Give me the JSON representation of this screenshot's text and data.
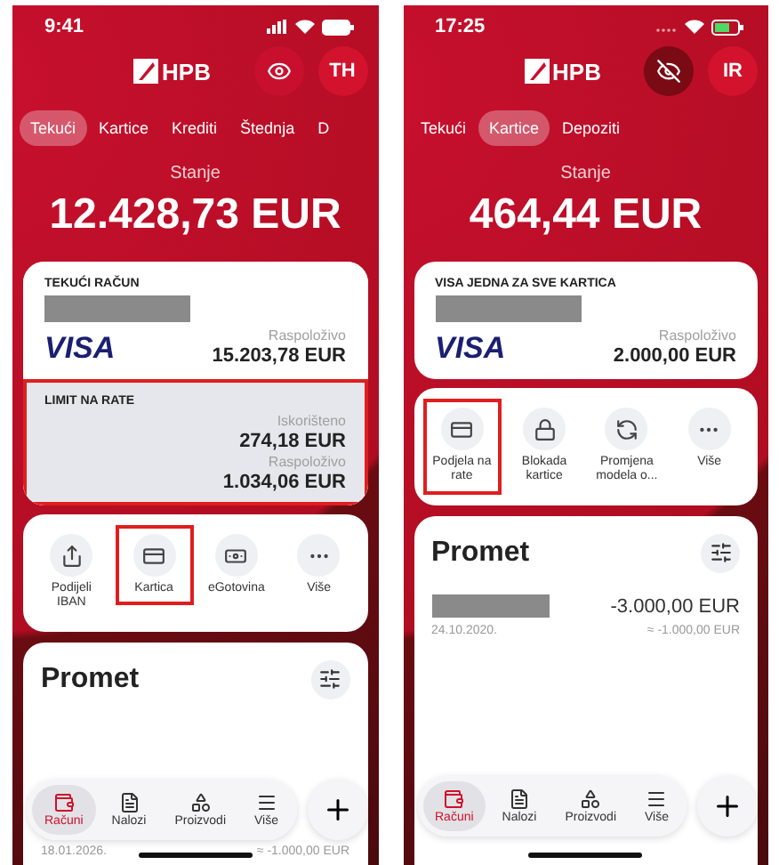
{
  "screens": [
    {
      "status": {
        "time": "9:41",
        "signal": true,
        "charging": false
      },
      "logo": "HPB",
      "privacy_hidden": false,
      "avatar": "TH",
      "tabs": [
        {
          "label": "Tekući",
          "selected": true
        },
        {
          "label": "Kartice",
          "selected": false
        },
        {
          "label": "Krediti",
          "selected": false
        },
        {
          "label": "Štednja",
          "selected": false
        },
        {
          "label": "D",
          "selected": false
        }
      ],
      "balance_label": "Stanje",
      "balance": "12.428,73 EUR",
      "cards": [
        {
          "kind": "account",
          "title": "TEKUĆI RAČUN",
          "brand": "VISA",
          "lines": [
            {
              "label": "Raspoloživo",
              "amount": "15.203,78 EUR"
            }
          ],
          "highlighted": false
        },
        {
          "kind": "limit",
          "title": "LIMIT NA RATE",
          "lines": [
            {
              "label": "Iskorišteno",
              "amount": "274,18 EUR"
            },
            {
              "label": "Raspoloživo",
              "amount": "1.034,06 EUR"
            }
          ],
          "highlighted": true
        }
      ],
      "actions": [
        {
          "kind": "share",
          "label": "Podijeli IBAN",
          "highlighted": false
        },
        {
          "kind": "card",
          "label": "Kartica",
          "highlighted": true
        },
        {
          "kind": "cash",
          "label": "eGotovina",
          "highlighted": false
        },
        {
          "kind": "more",
          "label": "Više",
          "highlighted": false
        }
      ],
      "promet": {
        "title": "Promet",
        "transaction": {
          "date": "18.01.2026.",
          "converted": "≈ -1.000,00 EUR"
        }
      },
      "nav": [
        {
          "kind": "wallet",
          "label": "Računi",
          "selected": true
        },
        {
          "kind": "doc",
          "label": "Nalozi",
          "selected": false
        },
        {
          "kind": "shapes",
          "label": "Proizvodi",
          "selected": false
        },
        {
          "kind": "menu",
          "label": "Više",
          "selected": false
        }
      ]
    },
    {
      "status": {
        "time": "17:25",
        "signal": false,
        "charging": true
      },
      "logo": "HPB",
      "privacy_hidden": true,
      "avatar": "IR",
      "tabs": [
        {
          "label": "Tekući",
          "selected": false
        },
        {
          "label": "Kartice",
          "selected": true
        },
        {
          "label": "Depoziti",
          "selected": false
        }
      ],
      "balance_label": "Stanje",
      "balance": "464,44 EUR",
      "cards": [
        {
          "kind": "account",
          "title": "VISA JEDNA ZA SVE KARTICA",
          "brand": "VISA",
          "lines": [
            {
              "label": "Raspoloživo",
              "amount": "2.000,00 EUR"
            }
          ],
          "highlighted": false
        }
      ],
      "actions": [
        {
          "kind": "split",
          "label": "Podjela na rate",
          "highlighted": true
        },
        {
          "kind": "lock",
          "label": "Blokada kartice",
          "highlighted": false
        },
        {
          "kind": "swap",
          "label": "Promjena modela o...",
          "highlighted": false
        },
        {
          "kind": "more",
          "label": "Više",
          "highlighted": false
        }
      ],
      "promet": {
        "title": "Promet",
        "transaction": {
          "amount": "-3.000,00 EUR",
          "date": "24.10.2020.",
          "converted": "≈ -1.000,00 EUR"
        }
      },
      "nav": [
        {
          "kind": "wallet",
          "label": "Računi",
          "selected": true
        },
        {
          "kind": "doc",
          "label": "Nalozi",
          "selected": false
        },
        {
          "kind": "shapes",
          "label": "Proizvodi",
          "selected": false
        },
        {
          "kind": "menu",
          "label": "Više",
          "selected": false
        }
      ]
    }
  ]
}
